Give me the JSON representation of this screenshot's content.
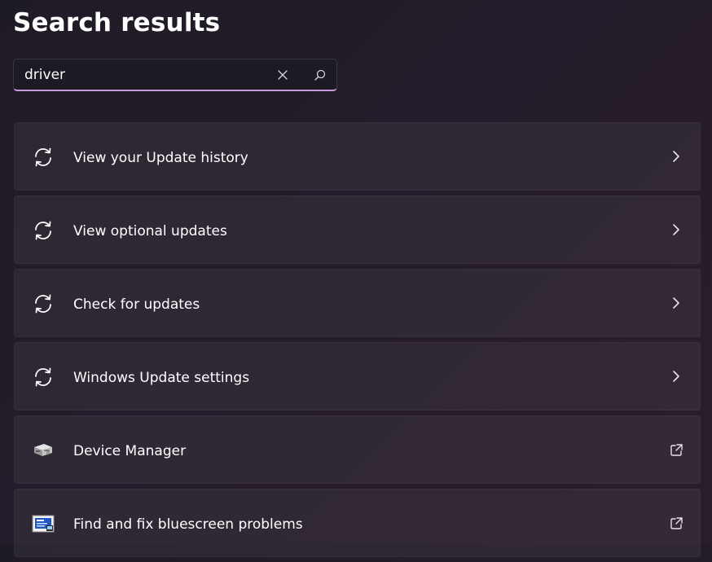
{
  "header": {
    "title": "Search results"
  },
  "search": {
    "value": "driver",
    "clear_icon": "close-icon",
    "search_icon": "search-icon"
  },
  "results": [
    {
      "label": "View your Update history",
      "icon": "sync-icon",
      "trailing": "chevron-right-icon"
    },
    {
      "label": "View optional updates",
      "icon": "sync-icon",
      "trailing": "chevron-right-icon"
    },
    {
      "label": "Check for updates",
      "icon": "sync-icon",
      "trailing": "chevron-right-icon"
    },
    {
      "label": "Windows Update settings",
      "icon": "sync-icon",
      "trailing": "chevron-right-icon"
    },
    {
      "label": "Device Manager",
      "icon": "device-manager-icon",
      "trailing": "external-link-icon"
    },
    {
      "label": "Find and fix bluescreen problems",
      "icon": "troubleshoot-screen-icon",
      "trailing": "external-link-icon"
    }
  ],
  "colors": {
    "accent": "#c99be0",
    "card_background": "#2b2530",
    "text": "#ffffff"
  }
}
